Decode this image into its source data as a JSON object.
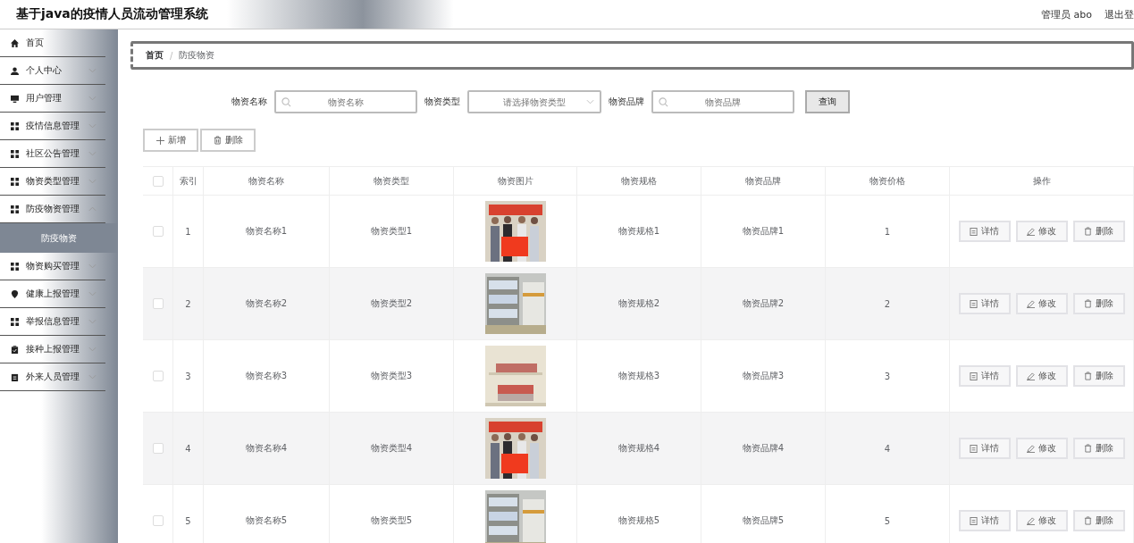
{
  "header": {
    "title": "基于java的疫情人员流动管理系统",
    "user": "管理员 abo",
    "logout": "退出登"
  },
  "sidebar": {
    "items": [
      {
        "label": "首页",
        "kind": "home",
        "has_submenu": false
      },
      {
        "label": "个人中心",
        "kind": "user",
        "has_submenu": true,
        "expanded": false
      },
      {
        "label": "用户管理",
        "kind": "monitor",
        "has_submenu": true,
        "expanded": false
      },
      {
        "label": "疫情信息管理",
        "kind": "grid",
        "has_submenu": true,
        "expanded": false
      },
      {
        "label": "社区公告管理",
        "kind": "grid",
        "has_submenu": true,
        "expanded": false
      },
      {
        "label": "物资类型管理",
        "kind": "grid",
        "has_submenu": true,
        "expanded": false
      },
      {
        "label": "防疫物资管理",
        "kind": "grid",
        "has_submenu": true,
        "expanded": true,
        "children": [
          {
            "label": "防疫物资",
            "selected": true
          }
        ]
      },
      {
        "label": "物资购买管理",
        "kind": "grid",
        "has_submenu": true,
        "expanded": false
      },
      {
        "label": "健康上报管理",
        "kind": "pin",
        "has_submenu": true,
        "expanded": false
      },
      {
        "label": "举报信息管理",
        "kind": "grid",
        "has_submenu": true,
        "expanded": false
      },
      {
        "label": "接种上报管理",
        "kind": "clipboard",
        "has_submenu": true,
        "expanded": false
      },
      {
        "label": "外来人员管理",
        "kind": "badge",
        "has_submenu": true,
        "expanded": false
      }
    ]
  },
  "breadcrumb": {
    "separator": "/",
    "items": [
      "首页",
      "防疫物资"
    ]
  },
  "search": {
    "fields": [
      {
        "label": "物资名称",
        "kind": "input",
        "placeholder": "物资名称"
      },
      {
        "label": "物资类型",
        "kind": "select",
        "placeholder": "请选择物资类型"
      },
      {
        "label": "物资品牌",
        "kind": "input",
        "placeholder": "物资品牌"
      }
    ],
    "button": "查询"
  },
  "actions": [
    "新增",
    "删除"
  ],
  "table": {
    "select_all_checked": false,
    "columns": [
      "索引",
      "物资名称",
      "物资类型",
      "物资图片",
      "物资规格",
      "物资品牌",
      "物资价格",
      "操作"
    ],
    "rows": [
      {
        "checked": false,
        "index": "1",
        "name": "物资名称1",
        "type": "物资类型1",
        "spec": "物资规格1",
        "brand": "物资品牌1",
        "price": "1",
        "actions": [
          "详情",
          "修改",
          "删除"
        ]
      },
      {
        "checked": false,
        "index": "2",
        "name": "物资名称2",
        "type": "物资类型2",
        "spec": "物资规格2",
        "brand": "物资品牌2",
        "price": "2",
        "actions": [
          "详情",
          "修改",
          "删除"
        ]
      },
      {
        "checked": false,
        "index": "3",
        "name": "物资名称3",
        "type": "物资类型3",
        "spec": "物资规格3",
        "brand": "物资品牌3",
        "price": "3",
        "actions": [
          "详情",
          "修改",
          "删除"
        ]
      },
      {
        "checked": false,
        "index": "4",
        "name": "物资名称4",
        "type": "物资类型4",
        "spec": "物资规格4",
        "brand": "物资品牌4",
        "price": "4",
        "actions": [
          "详情",
          "修改",
          "删除"
        ]
      },
      {
        "checked": false,
        "index": "5",
        "name": "物资名称5",
        "type": "物资类型5",
        "spec": "物资规格5",
        "brand": "物资品牌5",
        "price": "5",
        "actions": [
          "详情",
          "修改",
          "删除"
        ]
      }
    ]
  }
}
